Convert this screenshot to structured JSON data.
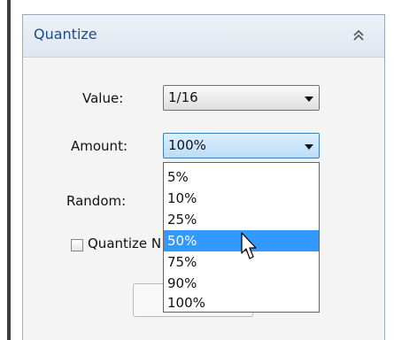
{
  "panel": {
    "title": "Quantize",
    "collapse_icon": "double-chevron-up-icon"
  },
  "value_field": {
    "label": "Value:",
    "selected": "1/16"
  },
  "amount_field": {
    "label": "Amount:",
    "selected": "100%",
    "options": [
      "5%",
      "10%",
      "25%",
      "50%",
      "75%",
      "90%",
      "100%"
    ],
    "highlighted": "50%"
  },
  "random_field": {
    "label": "Random:"
  },
  "checkbox": {
    "label": "Quantize N",
    "checked": false
  },
  "colors": {
    "title_text": "#1b4b86",
    "selection": "#3399ff",
    "header_bg": "#e6ecf4"
  }
}
